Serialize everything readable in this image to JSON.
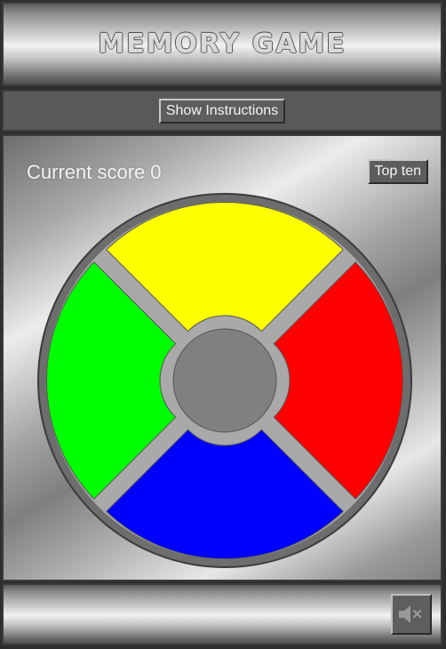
{
  "header": {
    "title": "MEMORY GAME"
  },
  "toolbar": {
    "instructions_label": "Show Instructions"
  },
  "scoreboard": {
    "label": "Current score",
    "value": "0",
    "top_ten_label": "Top ten"
  },
  "board": {
    "pads": {
      "top": {
        "color": "#ffff00"
      },
      "right": {
        "color": "#ff0000"
      },
      "bottom": {
        "color": "#0000ff"
      },
      "left": {
        "color": "#00ff00"
      }
    },
    "center_color": "#808080",
    "ring_color": "#6d6d6d",
    "separator_color": "#a9a9a9"
  },
  "footer": {
    "sound_icon": "speaker-muted-icon"
  }
}
